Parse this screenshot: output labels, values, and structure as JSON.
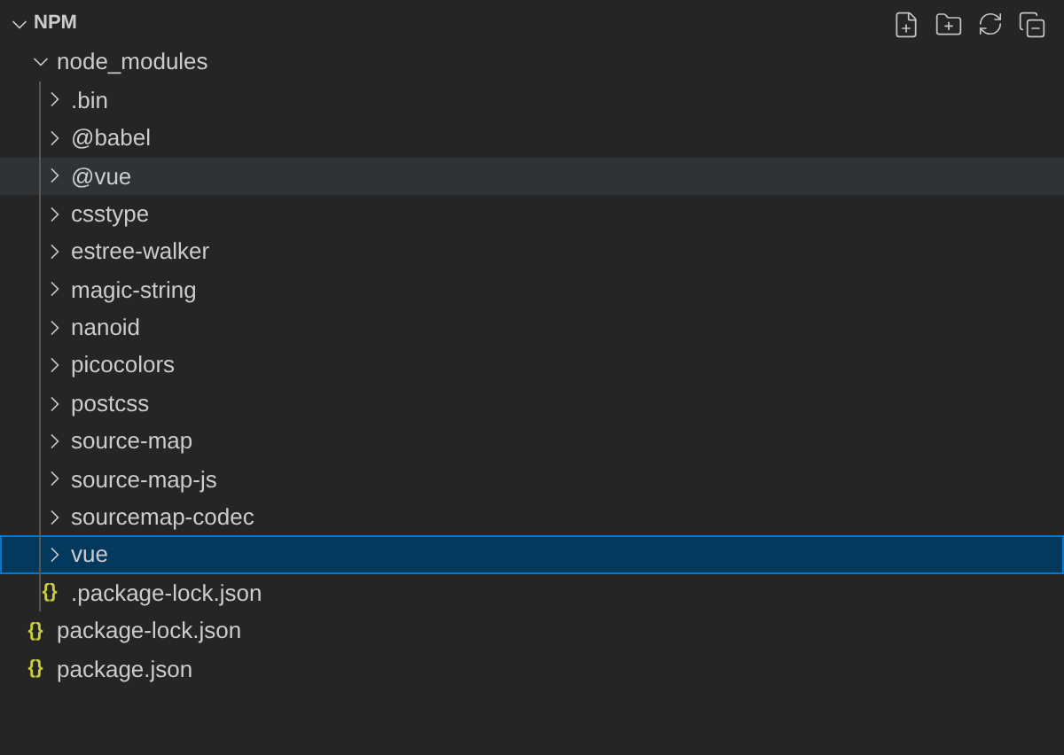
{
  "section": {
    "title": "NPM",
    "expanded": true
  },
  "tree": [
    {
      "kind": "folder",
      "label": "node_modules",
      "expanded": true,
      "selected": false,
      "hovered": false,
      "children": [
        {
          "kind": "folder",
          "label": ".bin",
          "expanded": false,
          "selected": false,
          "hovered": false
        },
        {
          "kind": "folder",
          "label": "@babel",
          "expanded": false,
          "selected": false,
          "hovered": false
        },
        {
          "kind": "folder",
          "label": "@vue",
          "expanded": false,
          "selected": false,
          "hovered": true
        },
        {
          "kind": "folder",
          "label": "csstype",
          "expanded": false,
          "selected": false,
          "hovered": false
        },
        {
          "kind": "folder",
          "label": "estree-walker",
          "expanded": false,
          "selected": false,
          "hovered": false
        },
        {
          "kind": "folder",
          "label": "magic-string",
          "expanded": false,
          "selected": false,
          "hovered": false
        },
        {
          "kind": "folder",
          "label": "nanoid",
          "expanded": false,
          "selected": false,
          "hovered": false
        },
        {
          "kind": "folder",
          "label": "picocolors",
          "expanded": false,
          "selected": false,
          "hovered": false
        },
        {
          "kind": "folder",
          "label": "postcss",
          "expanded": false,
          "selected": false,
          "hovered": false
        },
        {
          "kind": "folder",
          "label": "source-map",
          "expanded": false,
          "selected": false,
          "hovered": false
        },
        {
          "kind": "folder",
          "label": "source-map-js",
          "expanded": false,
          "selected": false,
          "hovered": false
        },
        {
          "kind": "folder",
          "label": "sourcemap-codec",
          "expanded": false,
          "selected": false,
          "hovered": false
        },
        {
          "kind": "folder",
          "label": "vue",
          "expanded": false,
          "selected": true,
          "hovered": false
        },
        {
          "kind": "file",
          "label": ".package-lock.json",
          "icon": "{}",
          "selected": false,
          "hovered": false
        }
      ]
    },
    {
      "kind": "file",
      "label": "package-lock.json",
      "icon": "{}",
      "selected": false,
      "hovered": false
    },
    {
      "kind": "file",
      "label": "package.json",
      "icon": "{}",
      "selected": false,
      "hovered": false
    }
  ]
}
